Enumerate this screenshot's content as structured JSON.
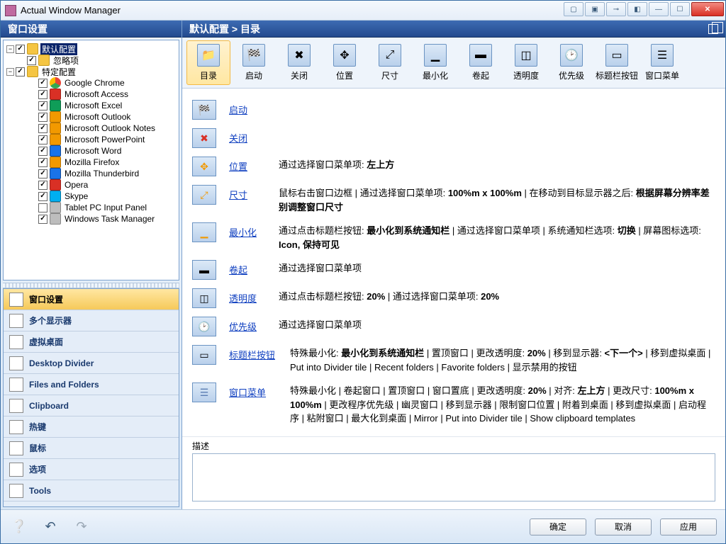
{
  "app": {
    "title": "Actual Window Manager"
  },
  "left_header": "窗口设置",
  "tree": {
    "root1": "默认配置",
    "root2": "忽略项",
    "root3": "特定配置",
    "apps": [
      {
        "label": "Google Chrome",
        "icon": "ic-chrome",
        "checked": true
      },
      {
        "label": "Microsoft Access",
        "icon": "ic-red",
        "checked": true
      },
      {
        "label": "Microsoft Excel",
        "icon": "ic-green",
        "checked": true
      },
      {
        "label": "Microsoft Outlook",
        "icon": "ic-orange",
        "checked": true
      },
      {
        "label": "Microsoft Outlook Notes",
        "icon": "ic-orange",
        "checked": true
      },
      {
        "label": "Microsoft PowerPoint",
        "icon": "ic-orange",
        "checked": true
      },
      {
        "label": "Microsoft Word",
        "icon": "ic-blue",
        "checked": true
      },
      {
        "label": "Mozilla Firefox",
        "icon": "ic-orange",
        "checked": true
      },
      {
        "label": "Mozilla Thunderbird",
        "icon": "ic-blue",
        "checked": true
      },
      {
        "label": "Opera",
        "icon": "ic-red",
        "checked": true
      },
      {
        "label": "Skype",
        "icon": "ic-sky",
        "checked": true
      },
      {
        "label": "Tablet PC Input Panel",
        "icon": "ic-gray",
        "checked": false
      },
      {
        "label": "Windows Task Manager",
        "icon": "ic-gray",
        "checked": true
      }
    ]
  },
  "nav": [
    "窗口设置",
    "多个显示器",
    "虚拟桌面",
    "Desktop Divider",
    "Files and Folders",
    "Clipboard",
    "热键",
    "鼠标",
    "选项",
    "Tools"
  ],
  "breadcrumb": "默认配置 > 目录",
  "toolbar": [
    "目录",
    "启动",
    "关闭",
    "位置",
    "尺寸",
    "最小化",
    "卷起",
    "透明度",
    "优先级",
    "标题栏按钮",
    "窗口菜单"
  ],
  "rows": {
    "startup": {
      "link": "启动",
      "desc": ""
    },
    "close": {
      "link": "关闭",
      "desc": ""
    },
    "position": {
      "link": "位置",
      "desc_pre": "通过选择窗口菜单项: ",
      "desc_b": "左上方"
    },
    "size": {
      "link": "尺寸",
      "desc_pre": "鼠标右击窗口边框 | 通过选择窗口菜单项: ",
      "desc_b1": "100%m x 100%m",
      "desc_mid": " | 在移动到目标显示器之后: ",
      "desc_b2": "根据屏幕分辨率差别调整窗口尺寸"
    },
    "minimize": {
      "link": "最小化",
      "desc_pre": "通过点击标题栏按钮: ",
      "desc_b1": "最小化到系统通知栏",
      "desc_mid": " | 通过选择窗口菜单项 | 系统通知栏选项: ",
      "desc_b2": "切换",
      "desc_mid2": " | 屏幕图标选项: ",
      "desc_b3": "Icon, 保持可见"
    },
    "rollup": {
      "link": "卷起",
      "desc": "通过选择窗口菜单项"
    },
    "transparency": {
      "link": "透明度",
      "desc_pre": "通过点击标题栏按钮: ",
      "desc_b1": "20%",
      "desc_mid": " | 通过选择窗口菜单项: ",
      "desc_b2": "20%"
    },
    "priority": {
      "link": "优先级",
      "desc": "通过选择窗口菜单项"
    },
    "titlebtn": {
      "link": "标题栏按钮",
      "desc_pre": "特殊最小化: ",
      "desc_b1": "最小化到系统通知栏",
      "desc_mid": " | 置顶窗口 | 更改透明度: ",
      "desc_b2": "20%",
      "desc_mid2": " | 移到显示器: ",
      "desc_b3": "<下一个>",
      "desc_tail": " | 移到虚拟桌面 | Put into Divider tile | Recent folders | Favorite folders | 显示禁用的按钮"
    },
    "winmenu": {
      "link": "窗口菜单",
      "desc_pre": "特殊最小化 | 卷起窗口 | 置顶窗口 | 窗口置底 | 更改透明度: ",
      "desc_b1": "20%",
      "desc_mid": " | 对齐: ",
      "desc_b2": "左上方",
      "desc_mid2": " | 更改尺寸: ",
      "desc_b3": "100%m x 100%m",
      "desc_tail": " | 更改程序优先级 | 幽灵窗口 | 移到显示器 | 限制窗口位置 | 附着到桌面 | 移到虚拟桌面 | 启动程序 | 粘附窗口 | 最大化到桌面 | Mirror | Put into Divider tile | Show clipboard templates"
    }
  },
  "desc_label": "描述",
  "footer": {
    "ok": "确定",
    "cancel": "取消",
    "apply": "应用"
  }
}
